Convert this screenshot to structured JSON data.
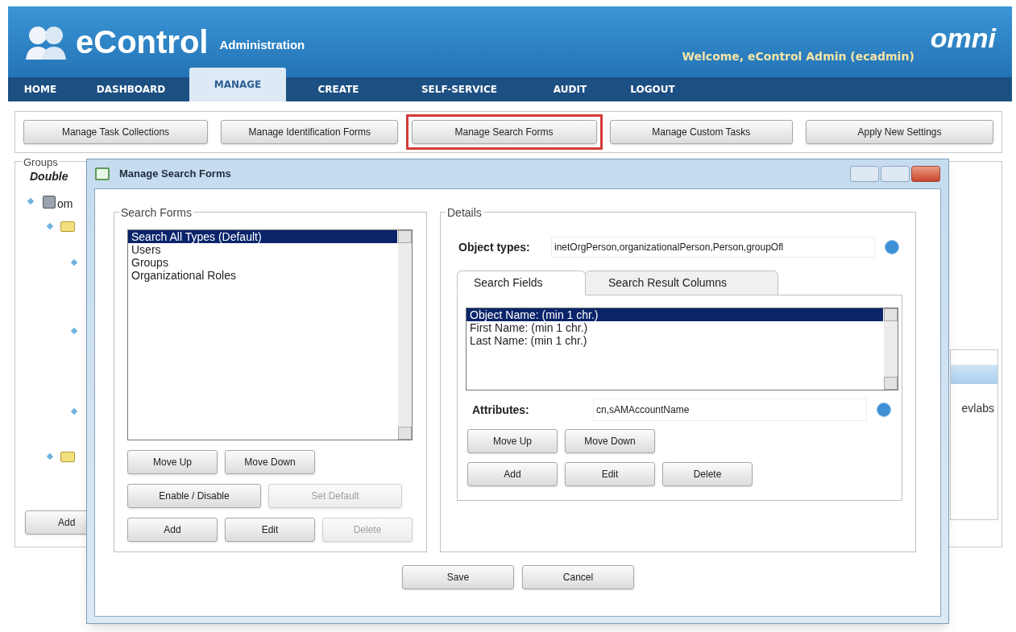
{
  "header": {
    "product": "eControl",
    "subtitle": "Administration",
    "welcome": "Welcome, eControl Admin (ecadmin)",
    "brand": "omni"
  },
  "nav": [
    {
      "label": "HOME",
      "selected": false
    },
    {
      "label": "DASHBOARD",
      "selected": false
    },
    {
      "label": "MANAGE",
      "selected": true
    },
    {
      "label": "CREATE",
      "selected": false
    },
    {
      "label": "SELF-SERVICE",
      "selected": false
    },
    {
      "label": "AUDIT",
      "selected": false
    },
    {
      "label": "LOGOUT",
      "selected": false
    }
  ],
  "toolbar": [
    {
      "label": "Manage Task Collections",
      "highlighted": false
    },
    {
      "label": "Manage Identification Forms",
      "highlighted": false
    },
    {
      "label": "Manage Search Forms",
      "highlighted": true
    },
    {
      "label": "Manage Custom Tasks",
      "highlighted": false
    },
    {
      "label": "Apply New Settings",
      "highlighted": false
    }
  ],
  "groups": {
    "legend": "Groups",
    "hint": "Double",
    "tree_root": "om",
    "add_button": "Add",
    "column_text": "evlabs"
  },
  "dialog": {
    "title": "Manage Search Forms",
    "search_forms": {
      "legend": "Search Forms",
      "items": [
        {
          "label": "Search All Types (Default)",
          "selected": true
        },
        {
          "label": "Users",
          "selected": false
        },
        {
          "label": "Groups",
          "selected": false
        },
        {
          "label": "Organizational Roles",
          "selected": false
        }
      ],
      "button_rows": [
        [
          {
            "label": "Move Up",
            "disabled": false
          },
          {
            "label": "Move Down",
            "disabled": false
          }
        ],
        [
          {
            "label": "Enable / Disable",
            "disabled": false
          },
          {
            "label": "Set Default",
            "disabled": true
          }
        ],
        [
          {
            "label": "Add",
            "disabled": false
          },
          {
            "label": "Edit",
            "disabled": false
          },
          {
            "label": "Delete",
            "disabled": true
          }
        ]
      ]
    },
    "details": {
      "legend": "Details",
      "object_types_label": "Object types:",
      "object_types_value": "inetOrgPerson,organizationalPerson,Person,groupOfl",
      "tabs": [
        {
          "label": "Search Fields",
          "selected": true
        },
        {
          "label": "Search Result Columns",
          "selected": false
        }
      ],
      "fields": [
        {
          "label": "Object Name: (min 1 chr.)",
          "selected": true
        },
        {
          "label": "First Name: (min 1 chr.)",
          "selected": false
        },
        {
          "label": "Last Name: (min 1 chr.)",
          "selected": false
        }
      ],
      "attributes_label": "Attributes:",
      "attributes_value": "cn,sAMAccountName",
      "button_rows": [
        [
          {
            "label": "Move Up",
            "disabled": false
          },
          {
            "label": "Move Down",
            "disabled": false
          }
        ],
        [
          {
            "label": "Add",
            "disabled": false
          },
          {
            "label": "Edit",
            "disabled": false
          },
          {
            "label": "Delete",
            "disabled": false
          }
        ]
      ]
    },
    "footer_buttons": [
      {
        "label": "Save",
        "disabled": false
      },
      {
        "label": "Cancel",
        "disabled": false
      }
    ]
  }
}
